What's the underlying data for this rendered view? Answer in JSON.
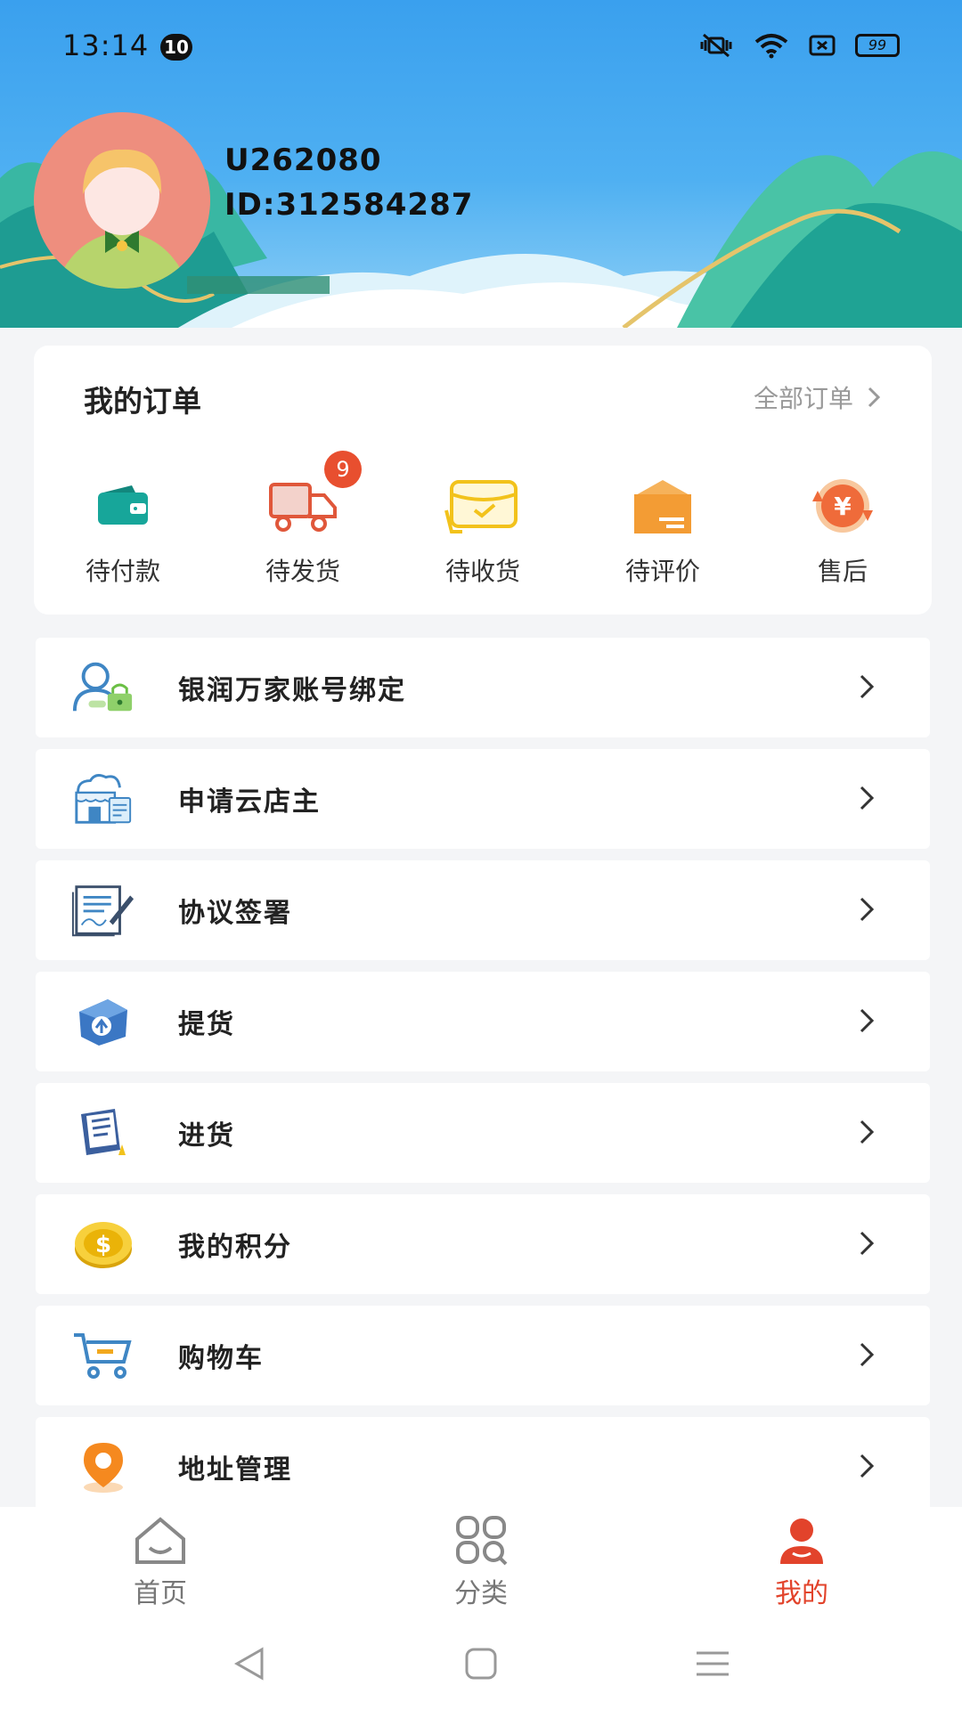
{
  "status_bar": {
    "time": "13:14",
    "notification_count": "10",
    "battery": "99"
  },
  "profile": {
    "username": "U262080",
    "id_text": "ID:312584287"
  },
  "orders": {
    "title": "我的订单",
    "all_link": "全部订单",
    "items": [
      {
        "label": "待付款",
        "icon": "wallet-icon"
      },
      {
        "label": "待发货",
        "icon": "truck-icon",
        "badge": "9"
      },
      {
        "label": "待收货",
        "icon": "receive-box-icon"
      },
      {
        "label": "待评价",
        "icon": "review-box-icon"
      },
      {
        "label": "售后",
        "icon": "after-sales-icon"
      }
    ]
  },
  "menu": [
    {
      "label": "银润万家账号绑定",
      "icon": "user-lock-icon"
    },
    {
      "label": "申请云店主",
      "icon": "cloud-shop-icon"
    },
    {
      "label": "协议签署",
      "icon": "contract-sign-icon"
    },
    {
      "label": "提货",
      "icon": "pickup-box-icon"
    },
    {
      "label": "进货",
      "icon": "purchase-notes-icon"
    },
    {
      "label": "我的积分",
      "icon": "coin-icon"
    },
    {
      "label": "购物车",
      "icon": "cart-icon"
    },
    {
      "label": "地址管理",
      "icon": "location-pin-icon"
    }
  ],
  "tabbar": [
    {
      "label": "首页",
      "icon": "home-icon",
      "active": false
    },
    {
      "label": "分类",
      "icon": "category-icon",
      "active": false
    },
    {
      "label": "我的",
      "icon": "profile-icon",
      "active": true
    }
  ],
  "colors": {
    "accent": "#e2432b",
    "header_blue": "#3aa0ee"
  }
}
